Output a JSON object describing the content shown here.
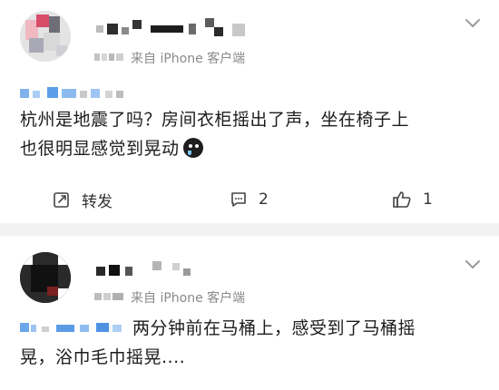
{
  "posts": [
    {
      "source": "来自 iPhone 客户端",
      "content_line1": "杭州是地震了吗？房间衣柜摇出了声，坐在椅子上",
      "content_line2": "也很明显感觉到晃动",
      "actions": {
        "forward_label": "转发",
        "comment_count": "2",
        "like_count": "1"
      }
    },
    {
      "source": "来自 iPhone 客户端",
      "content_line1": "两分钟前在马桶上，感受到了马桶摇",
      "content_line2": "晃，浴巾毛巾摇晃...."
    }
  ],
  "icons": {
    "menu": "chevron-down-icon",
    "forward": "forward-icon",
    "comment": "comment-icon",
    "like": "thumbs-up-icon",
    "emoji": "crying-emoji-icon"
  },
  "colors": {
    "text": "#1c1c1c",
    "meta": "#8a8a8a",
    "separator": "#f2f2f2",
    "pixel_blue": "#7fb2ec"
  }
}
